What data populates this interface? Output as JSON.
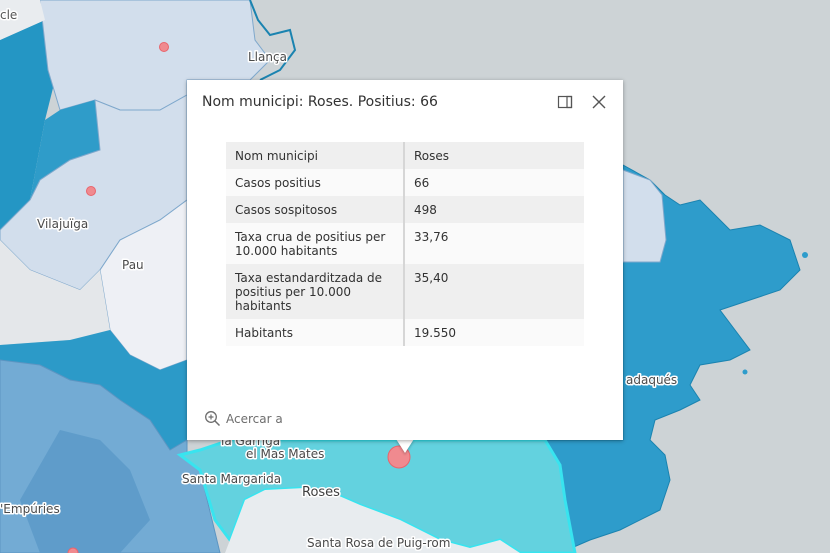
{
  "map": {
    "labels": {
      "llanca": "Llança",
      "vilajuiga": "Vilajuïga",
      "pau": "Pau",
      "cadaques": "adaqués",
      "la_garriga": "la Garriga",
      "el_mas_mates": "el Mas Mates",
      "santa_margarida": "Santa Margarida",
      "roses": "Roses",
      "empuries": "'Empúries",
      "santa_rosa": "Santa Rosa de Puig-rom",
      "corner": "cle"
    },
    "colors": {
      "sea": "#cdd3d6",
      "light_region": "#cfdbea",
      "blue_region": "#2f9cc9",
      "cyan_highlight": "#63d2df",
      "covid_dot": "#f08a8f"
    }
  },
  "popup": {
    "title": "Nom municipi: Roses. Positius: 66",
    "dock_icon": "dock-icon",
    "close_icon": "close-icon",
    "zoom_icon": "zoom-in-icon",
    "zoom_label": "Acercar a",
    "rows": [
      {
        "name": "Nom municipi",
        "value": "Roses"
      },
      {
        "name": "Casos positius",
        "value": "66"
      },
      {
        "name": "Casos sospitosos",
        "value": "498"
      },
      {
        "name": "Taxa crua de positius per 10.000 habitants",
        "value": "33,76"
      },
      {
        "name": "Taxa estandarditzada de positius per 10.000 habitants",
        "value": "35,40"
      },
      {
        "name": "Habitants",
        "value": "19.550"
      }
    ]
  }
}
